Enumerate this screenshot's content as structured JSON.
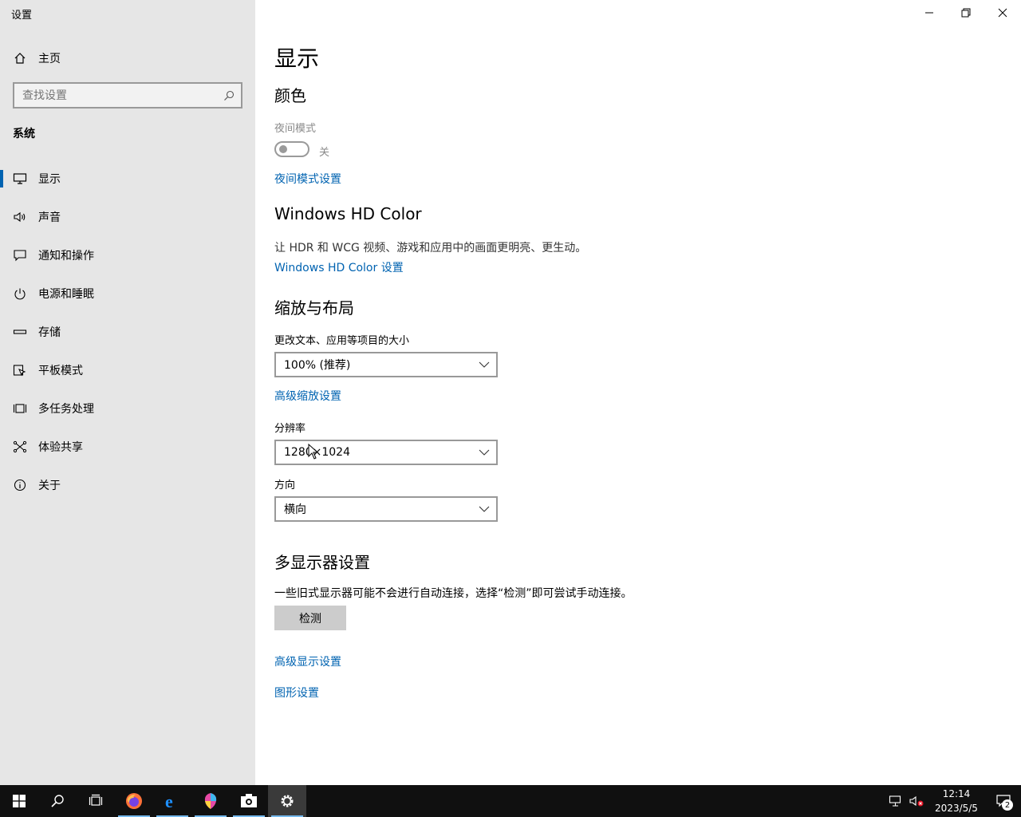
{
  "window": {
    "title": "设置"
  },
  "sidebar": {
    "home_label": "主页",
    "search_placeholder": "查找设置",
    "section_label": "系统",
    "items": [
      {
        "label": "显示",
        "icon": "monitor-icon",
        "active": true
      },
      {
        "label": "声音",
        "icon": "speaker-icon",
        "active": false
      },
      {
        "label": "通知和操作",
        "icon": "message-icon",
        "active": false
      },
      {
        "label": "电源和睡眠",
        "icon": "power-icon",
        "active": false
      },
      {
        "label": "存储",
        "icon": "storage-icon",
        "active": false
      },
      {
        "label": "平板模式",
        "icon": "tablet-icon",
        "active": false
      },
      {
        "label": "多任务处理",
        "icon": "multitask-icon",
        "active": false
      },
      {
        "label": "体验共享",
        "icon": "share-icon",
        "active": false
      },
      {
        "label": "关于",
        "icon": "info-icon",
        "active": false
      }
    ]
  },
  "main": {
    "page_title": "显示",
    "color": {
      "heading": "颜色",
      "night_mode_label": "夜间模式",
      "toggle_state": "关",
      "night_mode_settings_link": "夜间模式设置"
    },
    "hd_color": {
      "heading": "Windows HD Color",
      "description": "让 HDR 和 WCG 视频、游戏和应用中的画面更明亮、更生动。",
      "settings_link": "Windows HD Color 设置"
    },
    "scale_layout": {
      "heading": "缩放与布局",
      "scale_label": "更改文本、应用等项目的大小",
      "scale_value": "100% (推荐)",
      "advanced_scaling_link": "高级缩放设置",
      "resolution_label": "分辨率",
      "resolution_value": "1280×1024",
      "orientation_label": "方向",
      "orientation_value": "横向"
    },
    "multi_display": {
      "heading": "多显示器设置",
      "description": "一些旧式显示器可能不会进行自动连接，选择“检测”即可尝试手动连接。",
      "detect_button": "检测",
      "advanced_display_link": "高级显示设置",
      "graphics_settings_link": "图形设置"
    }
  },
  "taskbar": {
    "apps": [
      "start-icon",
      "search-icon",
      "task-view-icon",
      "firefox-icon",
      "edge-icon",
      "paint-icon",
      "camera-icon",
      "settings-icon"
    ],
    "clock_time": "12:14",
    "clock_date": "2023/5/5",
    "notification_count": "2"
  },
  "colors": {
    "accent": "#0063b1",
    "sidebar_bg": "#e6e6e6",
    "taskbar_bg": "#101010"
  }
}
